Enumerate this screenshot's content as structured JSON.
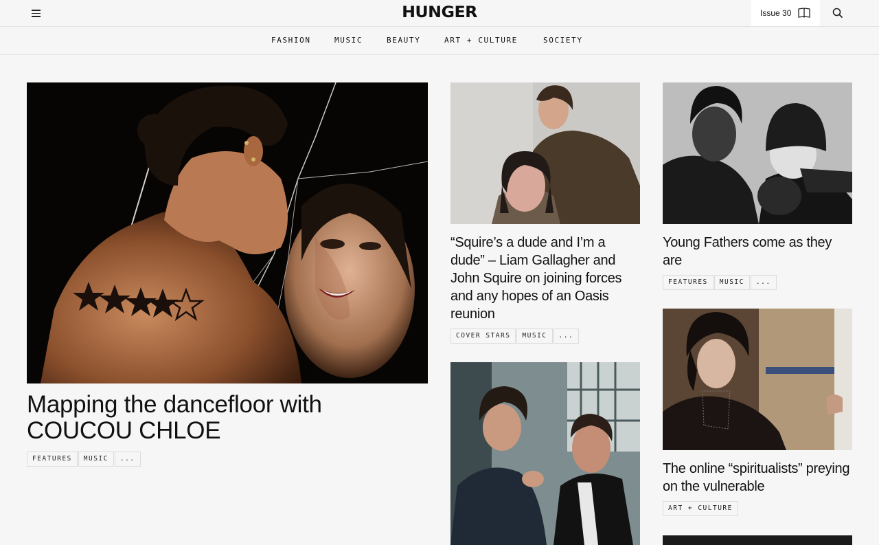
{
  "header": {
    "logo": "HUNGER",
    "issue_label": "Issue 30"
  },
  "nav": [
    "FASHION",
    "MUSIC",
    "BEAUTY",
    "ART + CULTURE",
    "SOCIETY"
  ],
  "articles": [
    {
      "headline": "Mapping the dancefloor with COUCOU CHLOE",
      "tags": [
        "FEATURES",
        "MUSIC",
        "..."
      ]
    },
    {
      "headline": "“Squire’s a dude and I’m a dude” – Liam Gallagher and John Squire on joining forces and any hopes of an Oasis reunion",
      "tags": [
        "COVER STARS",
        "MUSIC",
        "..."
      ]
    },
    {
      "headline": "Young Fathers come as they are",
      "tags": [
        "FEATURES",
        "MUSIC",
        "..."
      ]
    },
    {
      "headline": "The online “spiritualists” preying on the vulnerable",
      "tags": [
        "ART + CULTURE"
      ]
    }
  ],
  "icons": {
    "menu": "hamburger-icon",
    "issue": "book-open-icon",
    "search": "search-icon"
  },
  "colors": {
    "background": "#f6f6f6",
    "text": "#111111",
    "border": "#e2e2e2"
  }
}
